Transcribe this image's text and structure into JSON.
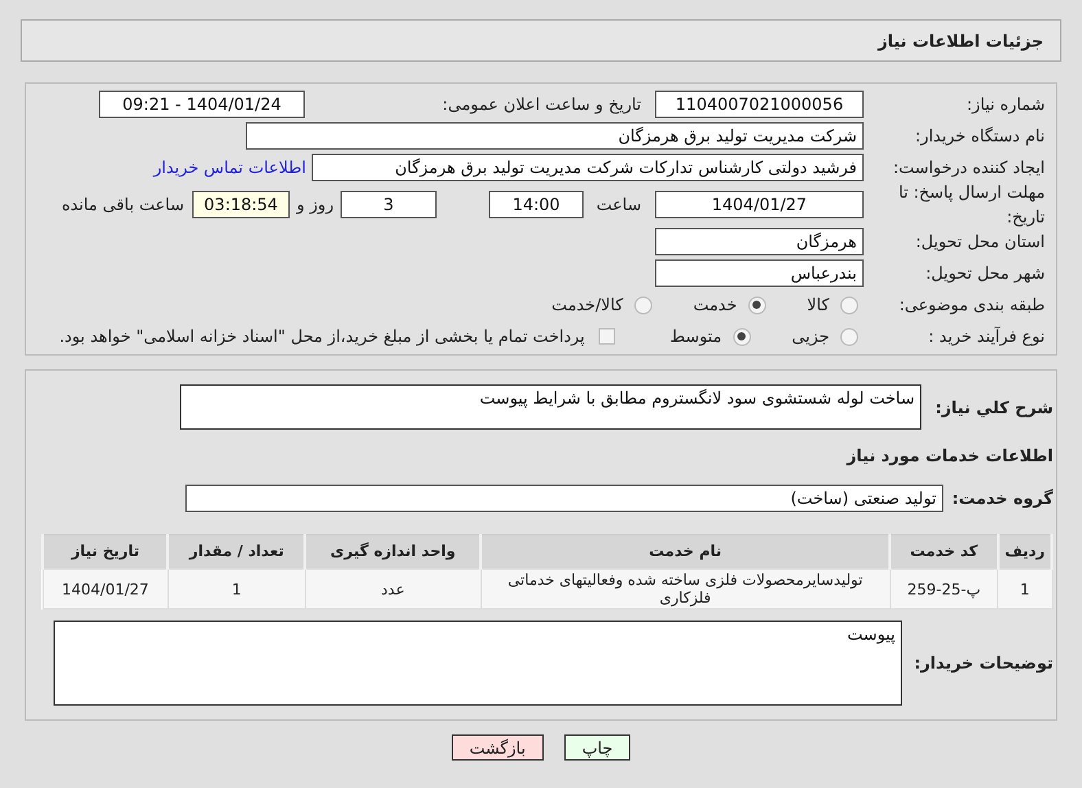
{
  "header": {
    "title": "جزئیات اطلاعات نیاز"
  },
  "details": {
    "need_number": {
      "label": "شماره نیاز:",
      "value": "1104007021000056"
    },
    "announce": {
      "label": "تاریخ و ساعت اعلان عمومی:",
      "value": "1404/01/24 - 09:21"
    },
    "buyer": {
      "label": "نام دستگاه خریدار:",
      "value": "شرکت مدیریت تولید برق هرمزگان"
    },
    "creator": {
      "label": "ایجاد کننده درخواست:",
      "value": "فرشید دولتی کارشناس تدارکات شرکت مدیریت تولید برق هرمزگان",
      "link": "اطلاعات تماس خریدار"
    },
    "deadline": {
      "label": "مهلت ارسال پاسخ: تا تاریخ:",
      "date": "1404/01/27",
      "time_label": "ساعت",
      "time": "14:00",
      "days": "3",
      "days_label": "روز و",
      "remaining": "03:18:54",
      "remaining_label": "ساعت باقی مانده"
    },
    "province": {
      "label": "استان محل تحویل:",
      "value": "هرمزگان"
    },
    "city": {
      "label": "شهر محل تحویل:",
      "value": "بندرعباس"
    },
    "category": {
      "label": "طبقه بندی موضوعی:",
      "options": [
        {
          "label": "کالا",
          "selected": false
        },
        {
          "label": "خدمت",
          "selected": true
        },
        {
          "label": "کالا/خدمت",
          "selected": false
        }
      ]
    },
    "purchase": {
      "label": "نوع فرآیند خرید :",
      "options": [
        {
          "label": "جزیی",
          "selected": false
        },
        {
          "label": "متوسط",
          "selected": true
        }
      ],
      "payment": {
        "checked": false,
        "text": "پرداخت تمام یا بخشی از مبلغ خرید،از محل \"اسناد خزانه اسلامی\" خواهد بود."
      }
    }
  },
  "description": {
    "label": "شرح کلي نياز:",
    "value": "ساخت لوله شستشوی سود لانگستروم مطابق با شرایط پیوست"
  },
  "services_title": "اطلاعات خدمات مورد نیاز",
  "service_group": {
    "label": "گروه خدمت:",
    "value": "تولید صنعتی (ساخت)"
  },
  "table": {
    "columns": [
      "ردیف",
      "کد خدمت",
      "نام خدمت",
      "واحد اندازه گیری",
      "تعداد / مقدار",
      "تاریخ نیاز"
    ],
    "rows": [
      [
        "1",
        "پ-25-259",
        "تولیدسایرمحصولات فلزی ساخته شده وفعالیتهای خدماتی فلزکاری",
        "عدد",
        "1",
        "1404/01/27"
      ]
    ]
  },
  "buyer_notes": {
    "label": "توضیحات خریدار:",
    "value": "پیوست"
  },
  "buttons": [
    {
      "label": "چاپ",
      "kind": "print"
    },
    {
      "label": "بازگشت",
      "kind": "back"
    }
  ]
}
